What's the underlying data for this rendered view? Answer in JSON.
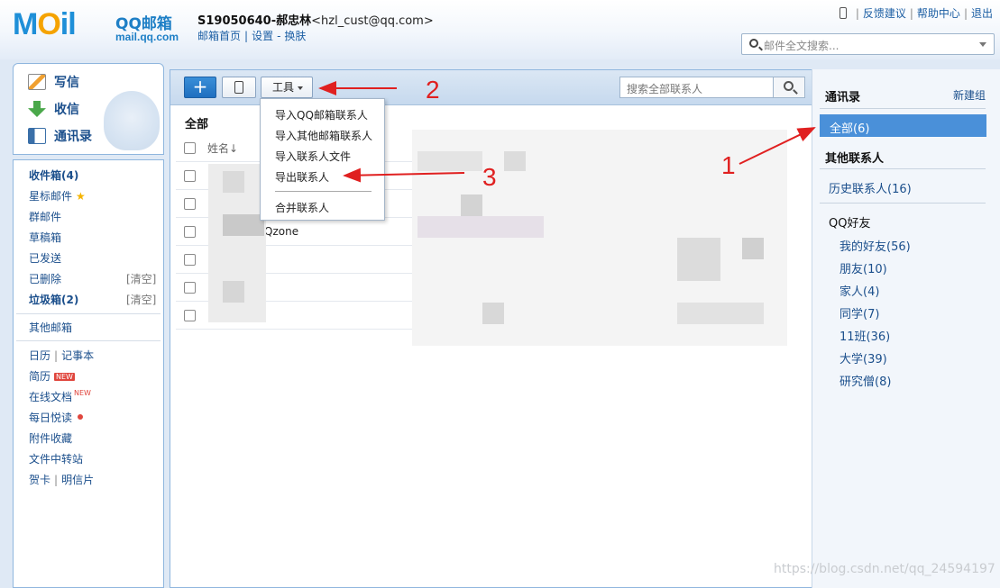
{
  "header": {
    "logo_m": "M",
    "logo_o": "O",
    "logo_il": "il",
    "logo_qq": "QQ邮箱",
    "logo_url": "mail.qq.com",
    "account_id": "S19050640-郝忠林",
    "account_email": "<hzl_cust@qq.com>",
    "links": [
      "邮箱首页",
      "设置",
      "换肤"
    ],
    "top_links": [
      "反馈建议",
      "帮助中心",
      "退出"
    ],
    "search_placeholder": "邮件全文搜索..."
  },
  "sidebar": {
    "primary": [
      {
        "label": "写信",
        "icon": "pencil-icon"
      },
      {
        "label": "收信",
        "icon": "inbox-download-icon"
      },
      {
        "label": "通讯录",
        "icon": "contact-card-icon"
      }
    ],
    "folders": [
      {
        "label": "收件箱(4)",
        "bold": true
      },
      {
        "label": "星标邮件",
        "icon": "star-icon"
      },
      {
        "label": "群邮件"
      },
      {
        "label": "草稿箱"
      },
      {
        "label": "已发送"
      },
      {
        "label": "已删除",
        "action": "[清空]"
      },
      {
        "label": "垃圾箱(2)",
        "bold": true,
        "action": "[清空]"
      }
    ],
    "other_mailbox": "其他邮箱",
    "apps": {
      "calendar": "日历",
      "notes": "记事本",
      "resume": "简历",
      "resume_badge": "NEW",
      "online_docs": "在线文档",
      "online_docs_badge": "NEW",
      "daily_read": "每日悦读",
      "attachments": "附件收藏",
      "transfer": "文件中转站",
      "greeting_card": "贺卡",
      "postcard": "明信片"
    }
  },
  "toolbar": {
    "add_label": "+",
    "tools_label": "工具",
    "search_placeholder": "搜索全部联系人"
  },
  "contacts": {
    "title": "全部",
    "name_header": "姓名↓",
    "rows": [
      "",
      "",
      "Qzone",
      "",
      "",
      ""
    ]
  },
  "tools_menu": {
    "items": [
      "导入QQ邮箱联系人",
      "导入其他邮箱联系人",
      "导入联系人文件",
      "导出联系人",
      "合并联系人"
    ]
  },
  "right_panel": {
    "title": "通讯录",
    "new_group": "新建组",
    "all": "全部(6)",
    "other_contacts": "其他联系人",
    "history": "历史联系人(16)",
    "qq_friends": "QQ好友",
    "groups": [
      "我的好友(56)",
      "朋友(10)",
      "家人(4)",
      "同学(7)",
      "11班(36)",
      "大学(39)",
      "研究僧(8)"
    ]
  },
  "annotations": [
    "1",
    "2",
    "3"
  ],
  "watermark": "https://blog.csdn.net/qq_24594197",
  "colors": {
    "accent_blue": "#4a90d9",
    "annotation_red": "#e02020",
    "link_blue": "#1b4f8c"
  }
}
